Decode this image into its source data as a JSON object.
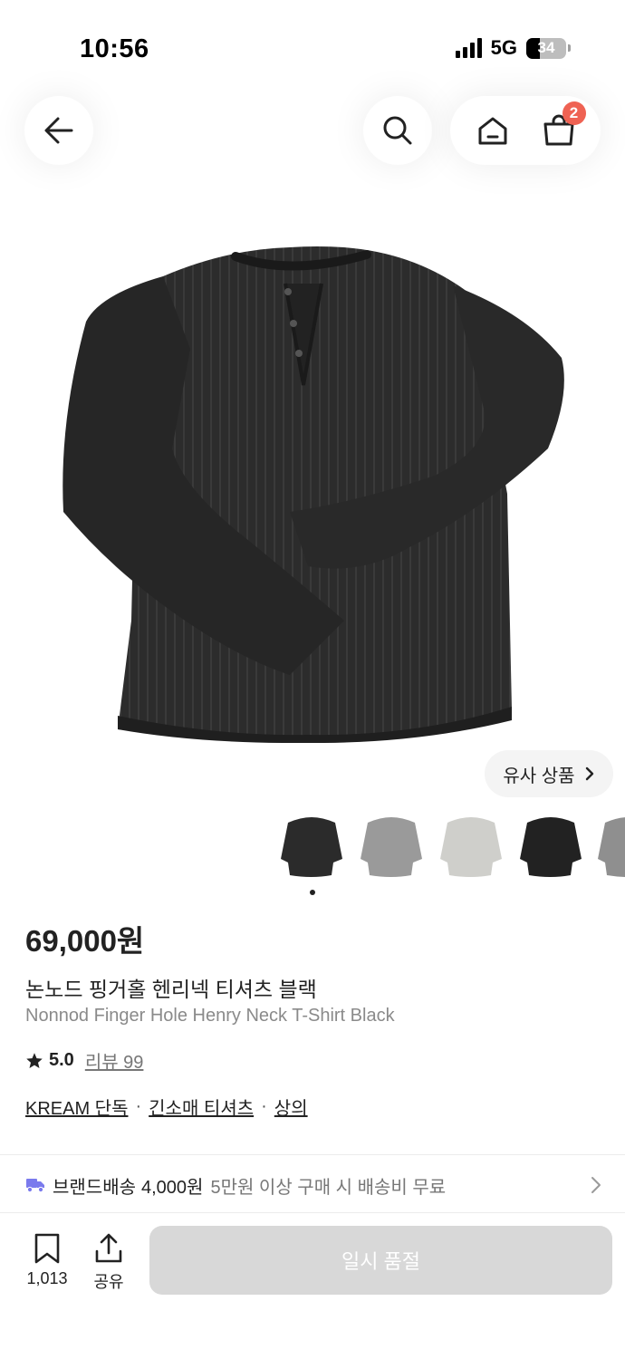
{
  "status_bar": {
    "time": "10:56",
    "network": "5G",
    "battery": "34"
  },
  "header": {
    "cart_count": "2"
  },
  "similar_button": {
    "label": "유사 상품"
  },
  "product": {
    "price": "69,000원",
    "name_ko": "논노드 핑거홀 헨리넥 티셔츠 블랙",
    "name_en": "Nonnod Finger Hole Henry Neck T-Shirt Black",
    "rating": "5.0",
    "review_label": "리뷰 99",
    "tags": [
      "KREAM 단독",
      "긴소매 티셔츠",
      "상의"
    ],
    "tag_separator": "·"
  },
  "shipping": {
    "label": "브랜드배송",
    "price": "4,000원",
    "note": "5만원 이상 구매 시 배송비 무료"
  },
  "bottom_bar": {
    "bookmark_count": "1,013",
    "share_label": "공유",
    "buy_label": "일시 품절"
  },
  "colors": {
    "badge": "#ef6253",
    "soldout_button": "#d8d8d8",
    "shipping_icon": "#7a7aed"
  }
}
